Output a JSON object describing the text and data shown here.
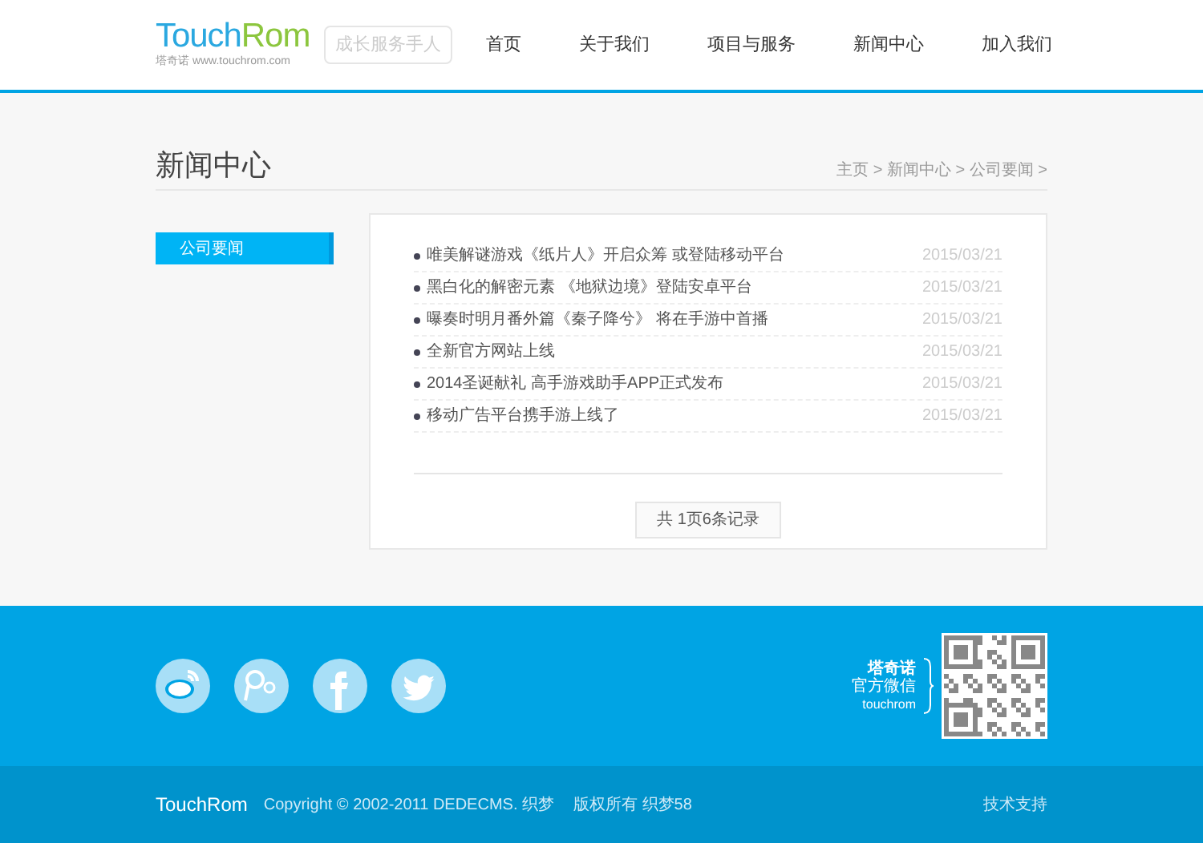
{
  "logo": {
    "parts": [
      {
        "text": "Touch",
        "color": "#2aa8e0"
      },
      {
        "text": "Rom",
        "color": "#8cc63e"
      }
    ],
    "tagline": "塔奇诺 www.touchrom.com"
  },
  "slogan": "成长服务手人",
  "nav": [
    {
      "label": "首页",
      "selected": false
    },
    {
      "label": "关于我们",
      "selected": false
    },
    {
      "label": "项目与服务",
      "selected": false
    },
    {
      "label": "新闻中心",
      "selected": false
    },
    {
      "label": "加入我们",
      "selected": false
    }
  ],
  "page_title": "新闻中心",
  "breadcrumb": "主页 > 新闻中心 > 公司要闻 >",
  "sidebar": {
    "items": [
      {
        "label": "公司要闻",
        "selected": true
      }
    ]
  },
  "news": [
    {
      "title": "唯美解谜游戏《纸片人》开启众筹 或登陆移动平台",
      "date": "2015/03/21"
    },
    {
      "title": "黑白化的解密元素 《地狱边境》登陆安卓平台",
      "date": "2015/03/21"
    },
    {
      "title": "曝奏时明月番外篇《秦子降兮》 将在手游中首播",
      "date": "2015/03/21"
    },
    {
      "title": "全新官方网站上线",
      "date": "2015/03/21"
    },
    {
      "title": "2014圣诞献礼 高手游戏助手APP正式发布",
      "date": "2015/03/21"
    },
    {
      "title": "移动广告平台携手游上线了",
      "date": "2015/03/21"
    }
  ],
  "pagination": "共 1页6条记录",
  "footer": {
    "wechat": {
      "name": "塔奇诺",
      "label": "官方微信",
      "account": "touchrom"
    },
    "logo": "TouchRom",
    "copyright": "Copyright © 2002-2011 DEDECMS. 织梦",
    "rights": "版权所有 织梦58",
    "support": "技术支持"
  }
}
